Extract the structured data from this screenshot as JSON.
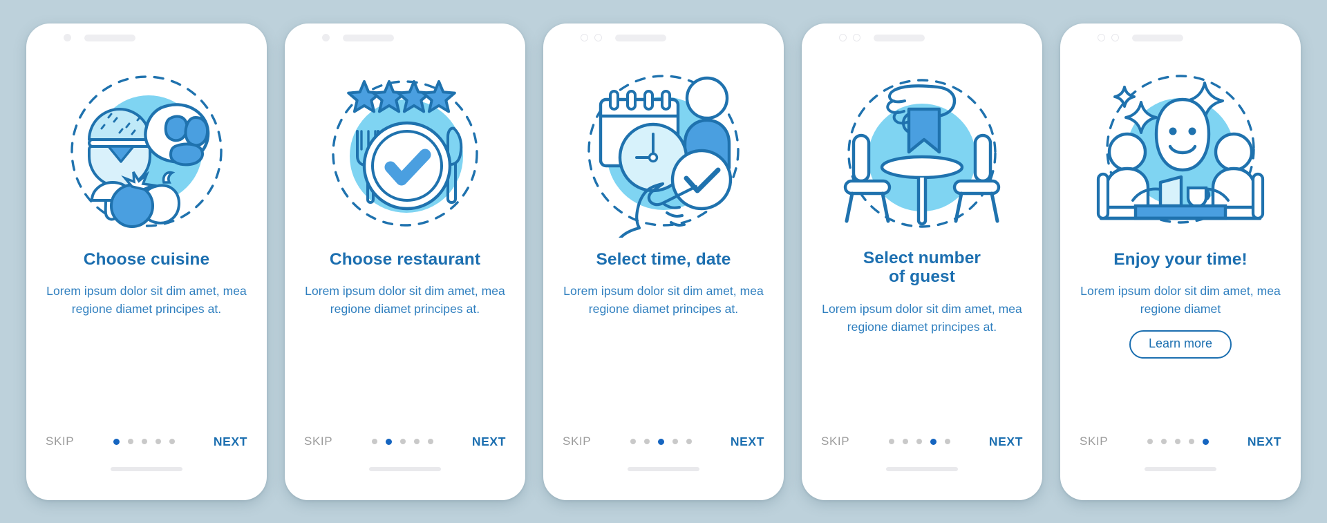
{
  "background_color": "#bdd1db",
  "colors": {
    "title": "#1c6fb0",
    "body_text": "#2f7fbf",
    "skip": "#9b9b9b",
    "next": "#1c6fb0",
    "dot_active": "#1565c0",
    "dot_inactive": "#c9c9c9",
    "accent_light": "#7fd4f2",
    "accent_mid": "#4a9fe0",
    "outline": "#1f72ae",
    "phone_body": "#ffffff"
  },
  "total_screens": 5,
  "screens": [
    {
      "id": "choose-cuisine",
      "icon": "cuisine-icon",
      "title": "Choose cuisine",
      "description": "Lorem ipsum dolor sit dim amet, mea regione diamet principes at.",
      "skip_label": "SKIP",
      "next_label": "NEXT",
      "active_dot": 0,
      "camera_style": "single-dot",
      "has_learn_more": false,
      "learn_more_label": ""
    },
    {
      "id": "choose-restaurant",
      "icon": "restaurant-rating-icon",
      "title": "Choose restaurant",
      "description": "Lorem ipsum dolor sit dim amet, mea regione diamet principes at.",
      "skip_label": "SKIP",
      "next_label": "NEXT",
      "active_dot": 1,
      "camera_style": "single-dot",
      "has_learn_more": false,
      "learn_more_label": ""
    },
    {
      "id": "select-time-date",
      "icon": "calendar-clock-icon",
      "title": "Select time, date",
      "description": "Lorem ipsum dolor sit dim amet, mea regione diamet principes at.",
      "skip_label": "SKIP",
      "next_label": "NEXT",
      "active_dot": 2,
      "camera_style": "double-ring",
      "has_learn_more": false,
      "learn_more_label": ""
    },
    {
      "id": "select-number-of-guest",
      "icon": "table-reserved-icon",
      "title": "Select number\nof guest",
      "description": "Lorem ipsum dolor sit dim amet, mea regione diamet principes at.",
      "skip_label": "SKIP",
      "next_label": "NEXT",
      "active_dot": 3,
      "camera_style": "double-ring",
      "has_learn_more": false,
      "learn_more_label": ""
    },
    {
      "id": "enjoy-your-time",
      "icon": "happy-diners-icon",
      "title": "Enjoy your time!",
      "description": "Lorem ipsum dolor sit dim amet, mea regione diamet",
      "skip_label": "SKIP",
      "next_label": "NEXT",
      "active_dot": 4,
      "camera_style": "double-ring",
      "has_learn_more": true,
      "learn_more_label": "Learn more"
    }
  ]
}
